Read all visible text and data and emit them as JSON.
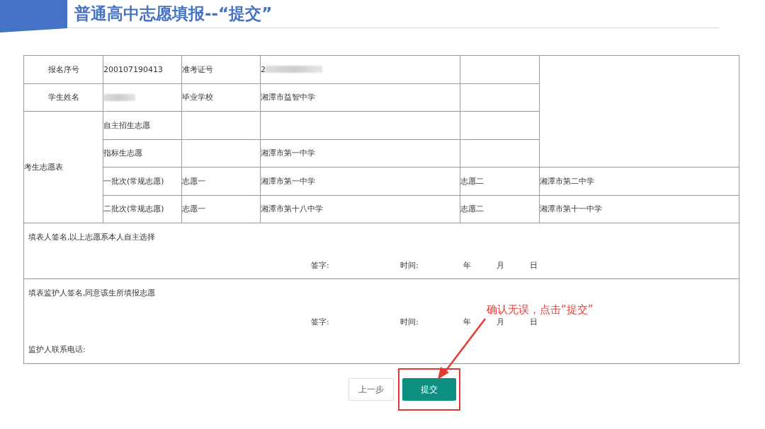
{
  "slide": {
    "title": "普通高中志愿填报--“提交”"
  },
  "info_rows": [
    {
      "label": "报名序号",
      "value": "200107190413",
      "label_2": "准考证号",
      "value_2": "2",
      "value_2_redacted": true
    },
    {
      "label": "学生姓名",
      "value_redacted": true,
      "label_2": "毕业学校",
      "value_2": "湘潭市益智中学"
    }
  ],
  "choices": {
    "label": "考生志愿表",
    "rows": [
      {
        "kind": "single",
        "label": "自主招生志愿"
      },
      {
        "kind": "single",
        "label": "指标生志愿",
        "school": "湘潭市第一中学"
      },
      {
        "kind": "pair",
        "label": "一批次(常规志愿)",
        "choice_1": "志愿一",
        "school_1": "湘潭市第一中学",
        "choice_2": "志愿二",
        "school_2": "湘潭市第二中学"
      },
      {
        "kind": "pair",
        "label": "二批次(常规志愿)",
        "choice_1": "志愿一",
        "school_1": "湘潭市第十八中学",
        "choice_2": "志愿二",
        "school_2": "湘潭市第十一中学"
      }
    ]
  },
  "signatures": [
    {
      "text": "填表人签名,以上志愿系本人自主选择",
      "sign_label": "签字:",
      "time_label": "时间:",
      "year": "年",
      "month": "月",
      "day": "日"
    },
    {
      "text": "填表监护人签名,同意该生所填报志愿",
      "sign_label": "签字:",
      "time_label": "时间:",
      "year": "年",
      "month": "月",
      "day": "日",
      "phone_label": "监护人联系电话:"
    }
  ],
  "buttons": [
    {
      "label": "上一步",
      "kind": "secondary",
      "highlighted": false
    },
    {
      "label": "提交",
      "kind": "primary",
      "highlighted": true
    }
  ],
  "annotation": {
    "text": "确认无误，点击“提交”"
  }
}
